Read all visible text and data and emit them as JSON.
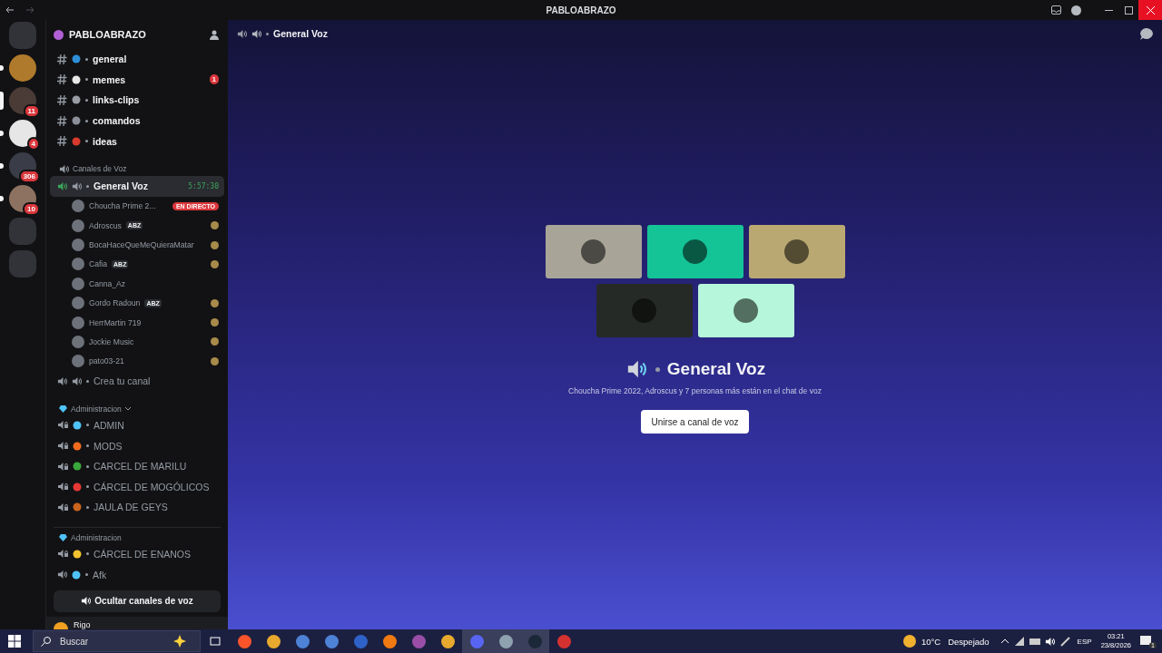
{
  "window": {
    "title": "PABLOABRAZO"
  },
  "servers": [
    {
      "selected": false
    },
    {
      "badge": "11",
      "selected": true
    },
    {
      "badge": "4",
      "selected": false
    },
    {
      "badge": "306",
      "selected": false
    },
    {
      "badge": "10",
      "selected": false
    }
  ],
  "server": {
    "name": "PABLOABRAZO"
  },
  "text_channels": [
    {
      "name": "general",
      "color": "#2f8fd8"
    },
    {
      "name": "memes",
      "badge": "1",
      "color": "#e8e8e8"
    },
    {
      "name": "links-clips",
      "color": "#9a9ca4"
    },
    {
      "name": "comandos",
      "color": "#8a8f99"
    },
    {
      "name": "ideas",
      "color": "#d83a2e"
    }
  ],
  "voice_category": {
    "name": "Canales de Voz"
  },
  "active_voice": {
    "name": "General Voz",
    "timer": "5:57:30",
    "selected": true
  },
  "members": [
    {
      "name": "Choucha Prime 2...",
      "live": "EN DIRECTO",
      "activity": false
    },
    {
      "name": "Adroscus",
      "tag": "ABZ",
      "activity": true
    },
    {
      "name": "BocaHaceQueMeQuieraMatar",
      "activity": true
    },
    {
      "name": "Cafia",
      "tag": "ABZ",
      "activity": true
    },
    {
      "name": "Canna_Az",
      "activity": false
    },
    {
      "name": "Gordo Radoun",
      "tag": "ABZ",
      "activity": true
    },
    {
      "name": "HerrMartin 719",
      "activity": true
    },
    {
      "name": "Jockie Music",
      "activity": true
    },
    {
      "name": "pato03-21",
      "activity": true
    }
  ],
  "open_voice": {
    "name": "Crea tu canal"
  },
  "categories": [
    {
      "name": "Administracion",
      "collapsible": true,
      "channels": [
        {
          "name": "ADMIN",
          "kind": "locked",
          "color": "#4fc3f7"
        },
        {
          "name": "MODS",
          "kind": "locked",
          "color": "#f26b1d"
        },
        {
          "name": "CARCEL DE MARILU",
          "kind": "locked",
          "color": "#3aa83a"
        },
        {
          "name": "CÁRCEL DE MOGÓLICOS",
          "kind": "locked",
          "color": "#e53935"
        },
        {
          "name": "JAULA DE GEYS",
          "kind": "locked",
          "color": "#c9641e"
        }
      ]
    },
    {
      "name": "Administracion",
      "collapsible": false,
      "channels": [
        {
          "name": "CÁRCEL DE ENANOS",
          "kind": "locked",
          "color": "#f2c230"
        },
        {
          "name": "Afk",
          "kind": "open",
          "color": "#4fc3f7"
        }
      ]
    }
  ],
  "hide_button": {
    "label": "Ocultar canales de voz"
  },
  "user": {
    "name": "Rigo"
  },
  "main": {
    "header": "General Voz",
    "tiles": [
      {
        "color": "#a8a598"
      },
      {
        "color": "#14c497"
      },
      {
        "color": "#b9a872"
      },
      {
        "color": "#262a26"
      },
      {
        "color": "#b6f6da"
      }
    ],
    "title": "General Voz",
    "subtitle": "Choucha Prime 2022, Adroscus y 7 personas más están en el chat de voz",
    "join": "Unirse a canal de voz"
  },
  "taskbar": {
    "search_placeholder": "Buscar",
    "temperature": "10°C",
    "weather": "Despejado",
    "language": "ESP",
    "time": "03:21",
    "date": "23/8/2026",
    "notifications": "1"
  }
}
